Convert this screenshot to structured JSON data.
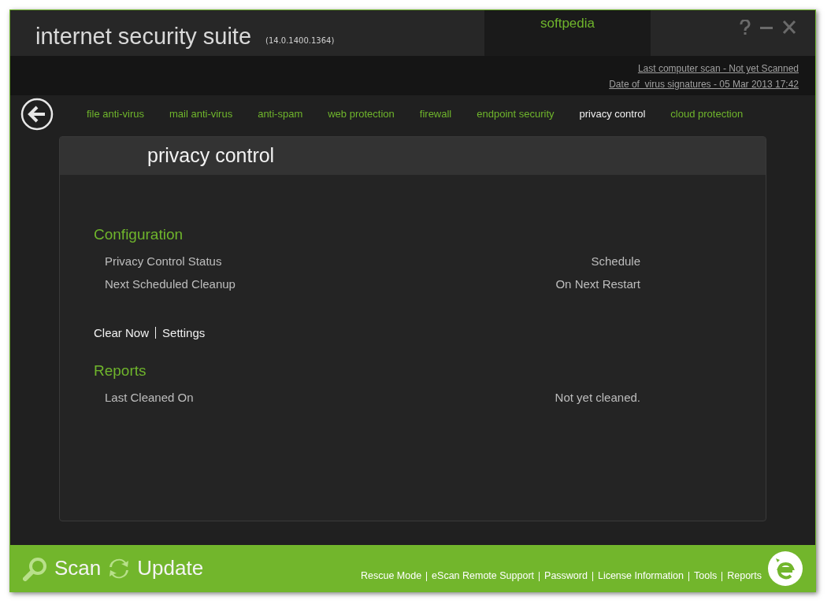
{
  "window": {
    "title": "internet security suite",
    "version": "(14.0.1400.1364)",
    "user_tab": "softpedia"
  },
  "status": {
    "last_scan": "Last computer scan - Not yet Scanned",
    "signatures": "Date of  virus signatures - 05 Mar 2013 17:42"
  },
  "tabs": [
    {
      "label": "file anti-virus",
      "selected": false
    },
    {
      "label": "mail anti-virus",
      "selected": false
    },
    {
      "label": "anti-spam",
      "selected": false
    },
    {
      "label": "web protection",
      "selected": false
    },
    {
      "label": "firewall",
      "selected": false
    },
    {
      "label": "endpoint security",
      "selected": false
    },
    {
      "label": "privacy control",
      "selected": true
    },
    {
      "label": "cloud protection",
      "selected": false
    }
  ],
  "panel": {
    "title": "privacy control",
    "configuration": {
      "heading": "Configuration",
      "rows": [
        {
          "label": "Privacy Control Status",
          "value": "Schedule"
        },
        {
          "label": "Next Scheduled Cleanup",
          "value": "On Next Restart"
        }
      ]
    },
    "actions": [
      "Clear Now",
      "Settings"
    ],
    "reports": {
      "heading": "Reports",
      "rows": [
        {
          "label": "Last Cleaned On",
          "value": "Not yet cleaned."
        }
      ]
    }
  },
  "footer": {
    "scan": "Scan",
    "update": "Update",
    "links": [
      "Rescue Mode",
      "eScan Remote Support",
      "Password",
      "License Information",
      "Tools",
      "Reports"
    ]
  }
}
